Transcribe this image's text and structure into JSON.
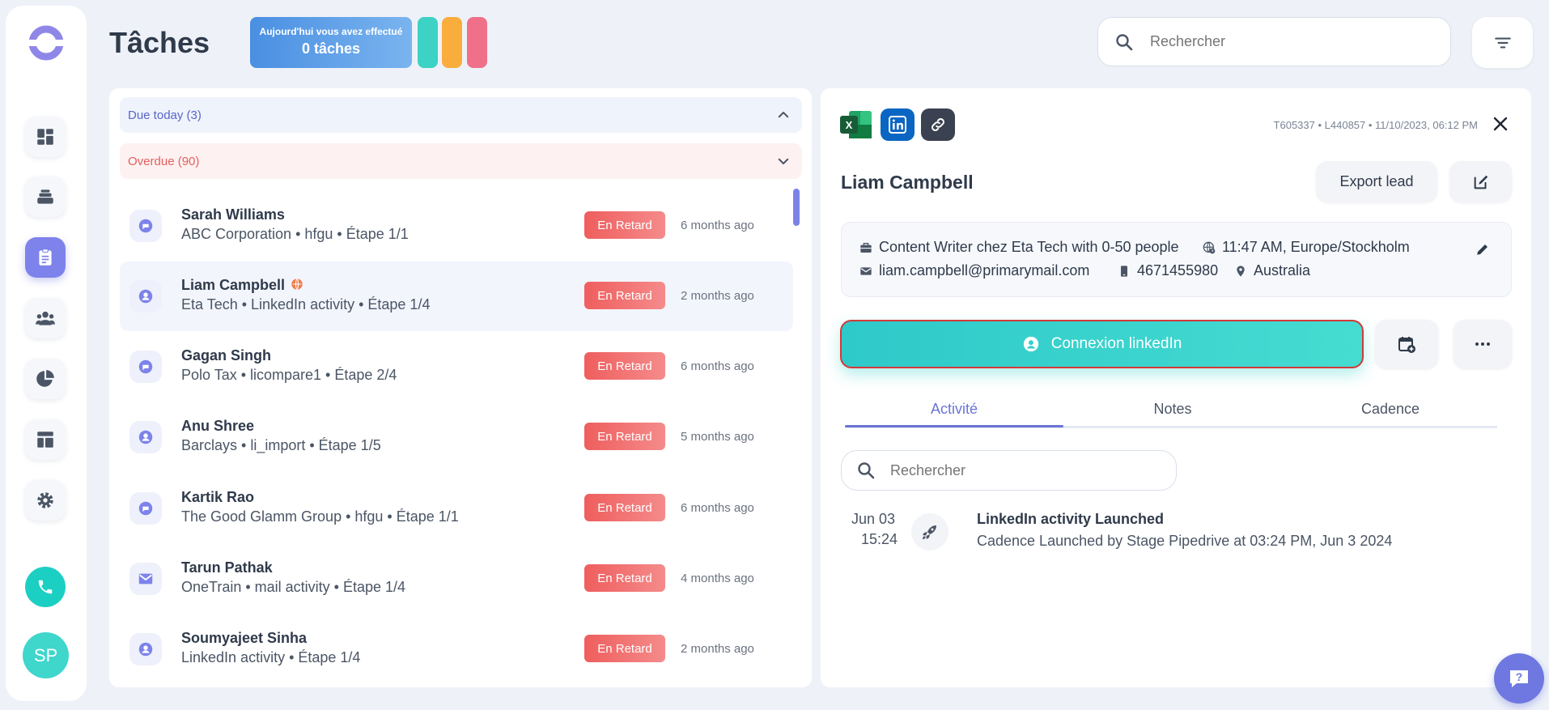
{
  "header": {
    "title": "Tâches",
    "stats_line1": "Aujourd'hui vous avez effectué",
    "stats_line2": "0 tâches",
    "search_placeholder": "Rechercher"
  },
  "colors": {
    "accent": "#7d83ea",
    "teal": "#2ec9c9",
    "pill_teal": "#3cd2c4",
    "pill_orange": "#f9ad3c",
    "pill_pink": "#f0708a",
    "overdue": "#ef5e5e"
  },
  "sidebar": {
    "items": [
      {
        "icon": "dashboard-icon"
      },
      {
        "icon": "layers-icon"
      },
      {
        "icon": "clipboard-icon",
        "active": true
      },
      {
        "icon": "group-icon"
      },
      {
        "icon": "pie-chart-icon"
      },
      {
        "icon": "layout-icon"
      },
      {
        "icon": "gear-icon"
      }
    ],
    "avatar_initials": "SP"
  },
  "tasks": {
    "due_today_label": "Due today (3)",
    "overdue_label": "Overdue (90)",
    "rows": [
      {
        "name": "Sarah Williams",
        "sub": "ABC Corporation • hfgu • Étape 1/1",
        "status": "En Retard",
        "time": "6 months ago",
        "icon": "chat-icon"
      },
      {
        "name": "Liam Campbell",
        "sub": "Eta Tech • LinkedIn activity • Étape 1/4",
        "status": "En Retard",
        "time": "2 months ago",
        "icon": "user-icon"
      },
      {
        "name": "Gagan Singh",
        "sub": "Polo Tax • licompare1 • Étape 2/4",
        "status": "En Retard",
        "time": "6 months ago",
        "icon": "chat-icon"
      },
      {
        "name": "Anu Shree",
        "sub": "Barclays • li_import • Étape 1/5",
        "status": "En Retard",
        "time": "5 months ago",
        "icon": "user-icon"
      },
      {
        "name": "Kartik Rao",
        "sub": "The Good Glamm Group • hfgu • Étape 1/1",
        "status": "En Retard",
        "time": "6 months ago",
        "icon": "chat-icon"
      },
      {
        "name": "Tarun Pathak",
        "sub": "OneTrain • mail activity • Étape 1/4",
        "status": "En Retard",
        "time": "4 months ago",
        "icon": "mail-icon"
      },
      {
        "name": "Soumyajeet Sinha",
        "sub": "LinkedIn activity • Étape 1/4",
        "status": "En Retard",
        "time": "2 months ago",
        "icon": "user-icon"
      }
    ]
  },
  "detail": {
    "meta": "T605337 • L440857 • 11/10/2023, 06:12 PM",
    "lead_name": "Liam Campbell",
    "export_label": "Export lead",
    "job": "Content Writer chez Eta Tech with 0-50 people",
    "local_time": "11:47 AM, Europe/Stockholm",
    "email": "liam.campbell@primarymail.com",
    "phone": "4671455980",
    "location": "Australia",
    "primary_action": "Connexion linkedIn",
    "tabs": [
      "Activité",
      "Notes",
      "Cadence"
    ],
    "search_placeholder": "Rechercher",
    "activity": {
      "date": "Jun 03",
      "time": "15:24",
      "title": "LinkedIn activity Launched",
      "description": "Cadence Launched by Stage Pipedrive at 03:24 PM, Jun 3 2024"
    }
  }
}
